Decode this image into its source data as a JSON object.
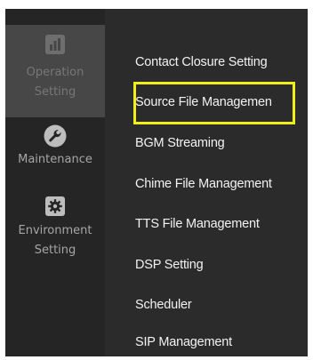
{
  "sidebar": {
    "items": [
      {
        "label_line1": "Operation",
        "label_line2": "Setting",
        "icon": "bar-chart-icon",
        "active": true
      },
      {
        "label_line1": "Maintenance",
        "label_line2": "",
        "icon": "wrench-icon",
        "active": false
      },
      {
        "label_line1": "Environment",
        "label_line2": "Setting",
        "icon": "gear-icon",
        "active": false
      }
    ]
  },
  "submenu": {
    "items": [
      {
        "label": "Contact Closure Setting"
      },
      {
        "label": "Source File Managemen"
      },
      {
        "label": "BGM Streaming"
      },
      {
        "label": "Chime File Management"
      },
      {
        "label": "TTS File Management"
      },
      {
        "label": "DSP Setting"
      },
      {
        "label": "Scheduler"
      },
      {
        "label": "SIP Management"
      }
    ],
    "highlighted_index": 1
  },
  "colors": {
    "sidebar_bg": "#252525",
    "sidebar_active_bg": "#474747",
    "submenu_bg": "#2b2b2b",
    "highlight": "#f2ee1a",
    "menu_text": "#f2f2f2"
  }
}
